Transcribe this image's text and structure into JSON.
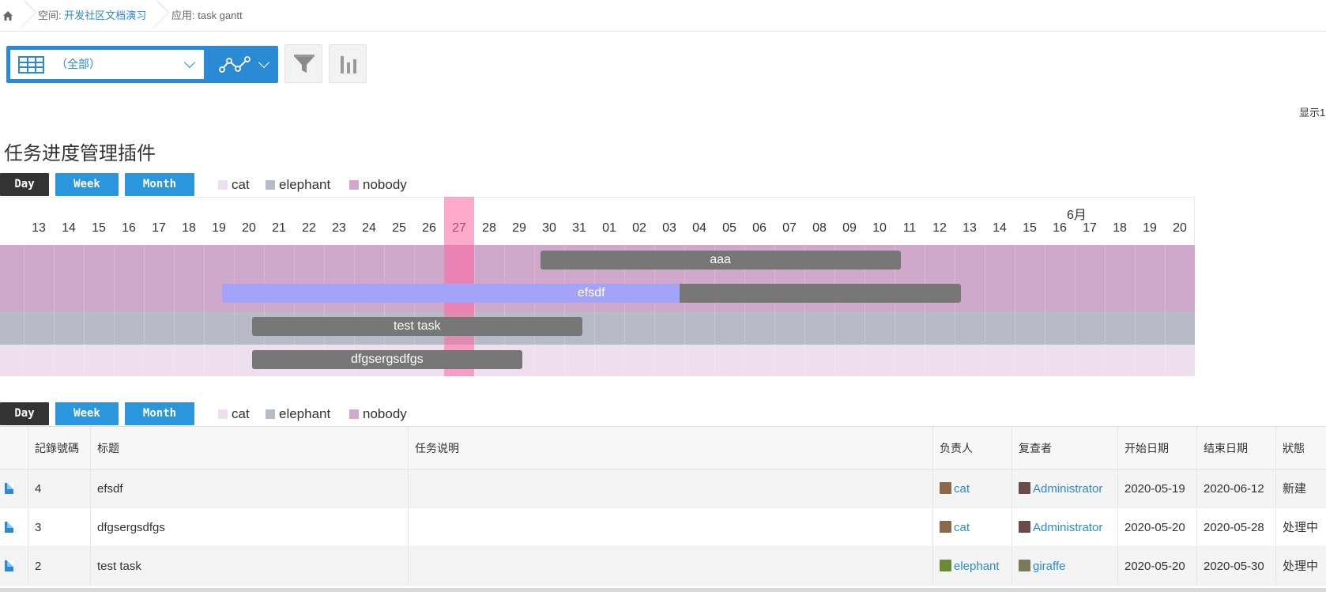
{
  "breadcrumb": {
    "space_prefix": "空间: ",
    "space_name": "开发社区文档演习",
    "app_label": "应用: task gantt"
  },
  "toolbar": {
    "view_select": "（全部）"
  },
  "display_text": "显示1",
  "title": "任务进度管理插件",
  "view_buttons": {
    "day": "Day",
    "week": "Week",
    "month": "Month"
  },
  "legend": [
    {
      "label": "cat",
      "color": "#eddfee"
    },
    {
      "label": "elephant",
      "color": "#b9bac8"
    },
    {
      "label": "nobody",
      "color": "#d0a8cc"
    }
  ],
  "gantt": {
    "month_label": "6月",
    "days": [
      "13",
      "14",
      "15",
      "16",
      "17",
      "18",
      "19",
      "20",
      "21",
      "22",
      "23",
      "24",
      "25",
      "26",
      "27",
      "28",
      "29",
      "30",
      "31",
      "01",
      "02",
      "03",
      "04",
      "05",
      "06",
      "07",
      "08",
      "09",
      "10",
      "11",
      "12",
      "13",
      "14",
      "15",
      "16",
      "17",
      "18",
      "19",
      "20"
    ],
    "today_index": 14,
    "month_start_index": 33,
    "rows": [
      {
        "group": "nobody",
        "task": "aaa",
        "start_index": 17.2,
        "end_index": 29.2,
        "progress": 0
      },
      {
        "group": "nobody",
        "task": "efsdf",
        "start_index": 6.6,
        "end_index": 31.2,
        "progress": 0.62
      },
      {
        "group": "elephant",
        "task": "test task",
        "start_index": 7.6,
        "end_index": 18.6,
        "progress": 0
      },
      {
        "group": "cat",
        "task": "dfgsergsdfgs",
        "start_index": 7.6,
        "end_index": 16.6,
        "progress": 0
      }
    ]
  },
  "table": {
    "columns": [
      "記錄號碼",
      "标题",
      "任务说明",
      "负责人",
      "复查者",
      "开始日期",
      "结束日期",
      "狀態"
    ],
    "rows": [
      {
        "id": "4",
        "title": "efsdf",
        "desc": "",
        "owner": "cat",
        "reviewer": "Administrator",
        "start": "2020-05-19",
        "end": "2020-06-12",
        "status": "新建"
      },
      {
        "id": "3",
        "title": "dfgsergsdfgs",
        "desc": "",
        "owner": "cat",
        "reviewer": "Administrator",
        "start": "2020-05-20",
        "end": "2020-05-28",
        "status": "处理中"
      },
      {
        "id": "2",
        "title": "test task",
        "desc": "",
        "owner": "elephant",
        "reviewer": "giraffe",
        "start": "2020-05-20",
        "end": "2020-05-30",
        "status": "处理中"
      }
    ]
  }
}
